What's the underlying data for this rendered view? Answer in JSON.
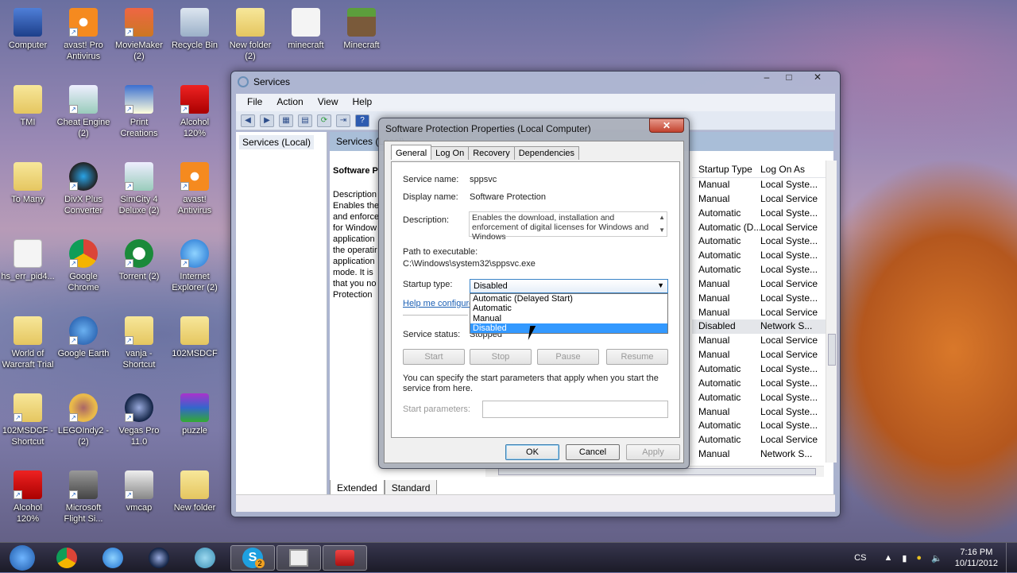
{
  "desktop": {
    "icons": [
      {
        "label": "Computer",
        "sub": "",
        "kind": "computer",
        "shortcut": false
      },
      {
        "label": "avast! Pro",
        "sub": "Antivirus",
        "kind": "avast",
        "shortcut": true
      },
      {
        "label": "MovieMaker",
        "sub": "(2)",
        "kind": "movie",
        "shortcut": true
      },
      {
        "label": "Recycle Bin",
        "sub": "",
        "kind": "recycle",
        "shortcut": false
      },
      {
        "label": "New folder",
        "sub": "(2)",
        "kind": "folder",
        "shortcut": false
      },
      {
        "label": "minecraft",
        "sub": "",
        "kind": "java",
        "shortcut": false
      },
      {
        "label": "Minecraft",
        "sub": "",
        "kind": "minecraft",
        "shortcut": false
      },
      {
        "label": "TMI",
        "sub": "",
        "kind": "folder",
        "shortcut": false
      },
      {
        "label": "Cheat Engine",
        "sub": "(2)",
        "kind": "window",
        "shortcut": true
      },
      {
        "label": "Print",
        "sub": "Creations",
        "kind": "print",
        "shortcut": true
      },
      {
        "label": "Alcohol",
        "sub": "120%",
        "kind": "alcohol",
        "shortcut": true
      },
      {
        "label": "To Many",
        "sub": "",
        "kind": "folder",
        "shortcut": false
      },
      {
        "label": "DivX Plus",
        "sub": "Converter",
        "kind": "divx",
        "shortcut": true
      },
      {
        "label": "SimCity 4",
        "sub": "Deluxe (2)",
        "kind": "window",
        "shortcut": true
      },
      {
        "label": "avast!",
        "sub": "Antivirus",
        "kind": "avast",
        "shortcut": true
      },
      {
        "label": "hs_err_pid4...",
        "sub": "",
        "kind": "doc",
        "shortcut": false
      },
      {
        "label": "Google",
        "sub": "Chrome",
        "kind": "chrome",
        "shortcut": true
      },
      {
        "label": "Torrent (2)",
        "sub": "",
        "kind": "torrent",
        "shortcut": true
      },
      {
        "label": "Internet",
        "sub": "Explorer (2)",
        "kind": "ie",
        "shortcut": true
      },
      {
        "label": "World of",
        "sub": "Warcraft Trial",
        "kind": "folder",
        "shortcut": false
      },
      {
        "label": "Google Earth",
        "sub": "",
        "kind": "earth",
        "shortcut": true
      },
      {
        "label": "vanja -",
        "sub": "Shortcut",
        "kind": "folder",
        "shortcut": true
      },
      {
        "label": "102MSDCF",
        "sub": "",
        "kind": "folder",
        "shortcut": false
      },
      {
        "label": "102MSDCF -",
        "sub": "Shortcut",
        "kind": "folder",
        "shortcut": true
      },
      {
        "label": "LEGOIndy2 -",
        "sub": "(2)",
        "kind": "lego",
        "shortcut": true
      },
      {
        "label": "Vegas Pro",
        "sub": "11.0",
        "kind": "vegas",
        "shortcut": true
      },
      {
        "label": "puzzle",
        "sub": "",
        "kind": "rar",
        "shortcut": false
      },
      {
        "label": "Alcohol",
        "sub": "120%",
        "kind": "alcohol",
        "shortcut": true
      },
      {
        "label": "Microsoft",
        "sub": "Flight Si...",
        "kind": "plane",
        "shortcut": true
      },
      {
        "label": "vmcap",
        "sub": "",
        "kind": "vmcap",
        "shortcut": true
      },
      {
        "label": "New folder",
        "sub": "",
        "kind": "folder",
        "shortcut": false
      }
    ]
  },
  "services_window": {
    "title": "Services",
    "controls": {
      "minimize": "–",
      "maximize": "□",
      "close": "✕"
    },
    "menu": [
      "File",
      "Action",
      "View",
      "Help"
    ],
    "toolbar_icons": [
      "back-icon",
      "forward-icon",
      "show-hide-console-tree-icon",
      "properties-icon",
      "refresh-icon",
      "export-list-icon",
      "help-icon"
    ],
    "tree_item": "Services (Local)",
    "pane_header": "Services (Local)",
    "service_title": "Software P",
    "service_desc_lines": [
      "Description",
      "Enables the",
      "and enforce",
      "for Window",
      "application",
      "the operatir",
      "application",
      "mode. It is",
      "that you no",
      "Protection"
    ],
    "columns": {
      "startup_type": "Startup Type",
      "log_on_as": "Log On As"
    },
    "rows": [
      [
        "Manual",
        "Local Syste..."
      ],
      [
        "Manual",
        "Local Service"
      ],
      [
        "Automatic",
        "Local Syste..."
      ],
      [
        "Automatic (D...",
        "Local Service"
      ],
      [
        "Automatic",
        "Local Syste..."
      ],
      [
        "Automatic",
        "Local Syste..."
      ],
      [
        "Automatic",
        "Local Syste..."
      ],
      [
        "Manual",
        "Local Service"
      ],
      [
        "Manual",
        "Local Syste..."
      ],
      [
        "Manual",
        "Local Service"
      ],
      [
        "Disabled",
        "Network S..."
      ],
      [
        "Manual",
        "Local Service"
      ],
      [
        "Manual",
        "Local Service"
      ],
      [
        "Automatic",
        "Local Syste..."
      ],
      [
        "Automatic",
        "Local Syste..."
      ],
      [
        "Automatic",
        "Local Syste..."
      ],
      [
        "Manual",
        "Local Syste..."
      ],
      [
        "Automatic",
        "Local Syste..."
      ],
      [
        "Automatic",
        "Local Service"
      ],
      [
        "Manual",
        "Network S..."
      ]
    ],
    "selected_row_index": 10,
    "bottom_tabs": [
      "Extended",
      "Standard"
    ]
  },
  "dialog": {
    "title": "Software Protection Properties (Local Computer)",
    "close": "✕",
    "tabs": [
      "General",
      "Log On",
      "Recovery",
      "Dependencies"
    ],
    "active_tab": "General",
    "service_name_label": "Service name:",
    "service_name": "sppsvc",
    "display_name_label": "Display name:",
    "display_name": "Software Protection",
    "description_label": "Description:",
    "description": "Enables the download, installation and enforcement of digital licenses for Windows and Windows",
    "path_label": "Path to executable:",
    "path": "C:\\Windows\\system32\\sppsvc.exe",
    "startup_type_label": "Startup type:",
    "startup_type_value": "Disabled",
    "startup_options": [
      "Automatic (Delayed Start)",
      "Automatic",
      "Manual",
      "Disabled"
    ],
    "highlighted_option": "Disabled",
    "help_link": "Help me configure",
    "service_status_label": "Service status:",
    "service_status": "Stopped",
    "buttons": {
      "start": "Start",
      "stop": "Stop",
      "pause": "Pause",
      "resume": "Resume"
    },
    "start_params_hint": "You can specify the start parameters that apply when you start the service from here.",
    "start_params_label": "Start parameters:",
    "start_params_value": "",
    "ok": "OK",
    "cancel": "Cancel",
    "apply": "Apply"
  },
  "taskbar": {
    "pinned": [
      "start-orb",
      "chrome",
      "internet-explorer",
      "vegas-pro",
      "bs-player",
      "skype",
      "vmcap",
      "toolbox"
    ],
    "skype_badge": "2",
    "language": "CS",
    "time": "7:16 PM",
    "date": "10/11/2012"
  }
}
